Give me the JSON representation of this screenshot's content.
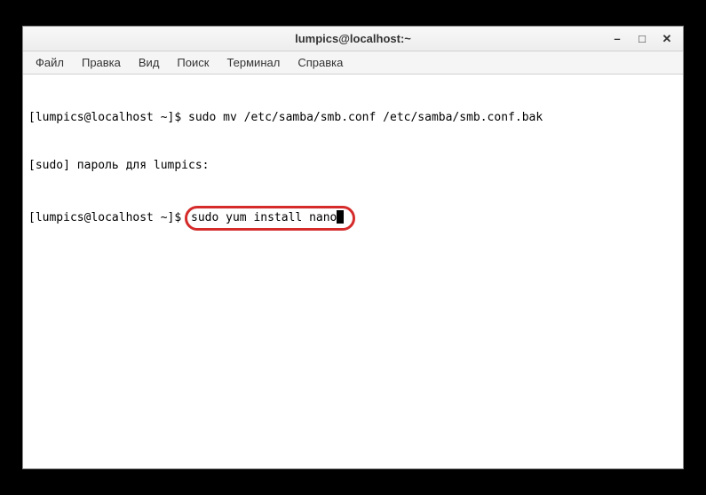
{
  "window": {
    "title": "lumpics@localhost:~"
  },
  "window_controls": {
    "minimize": "–",
    "maximize": "□",
    "close": "✕"
  },
  "menu": {
    "file": "Файл",
    "edit": "Правка",
    "view": "Вид",
    "search": "Поиск",
    "terminal": "Терминал",
    "help": "Справка"
  },
  "terminal": {
    "line1_prompt": "[lumpics@localhost ~]$ ",
    "line1_cmd": "sudo mv /etc/samba/smb.conf /etc/samba/smb.conf.bak",
    "line2": "[sudo] пароль для lumpics:",
    "line3_prompt": "[lumpics@localhost ~]$ ",
    "line3_cmd": "sudo yum install nano"
  },
  "highlight": {
    "color": "#d52b2b"
  }
}
